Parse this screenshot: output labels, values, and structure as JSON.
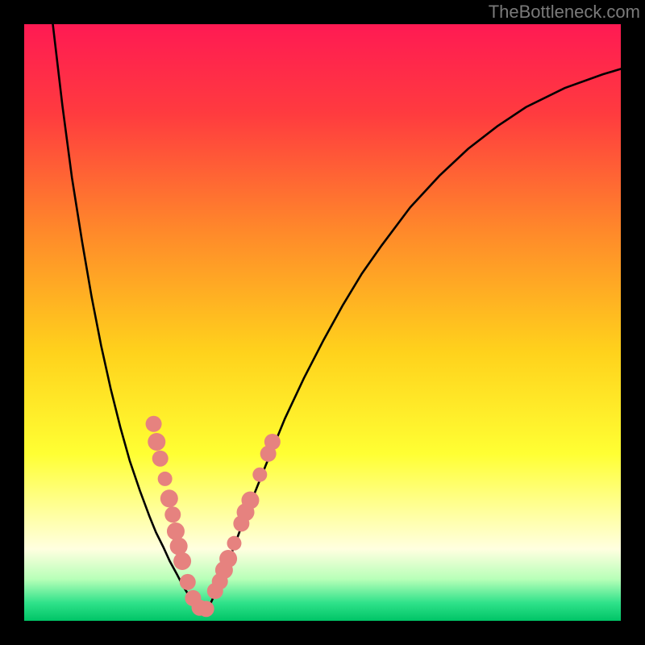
{
  "watermark": "TheBottleneck.com",
  "chart_data": {
    "type": "line",
    "title": "",
    "xlabel": "",
    "ylabel": "",
    "xlim": [
      0,
      1
    ],
    "ylim": [
      0,
      1
    ],
    "gradient_stops": [
      {
        "offset": 0.0,
        "color": "#ff1a53"
      },
      {
        "offset": 0.15,
        "color": "#ff3b3f"
      },
      {
        "offset": 0.35,
        "color": "#ff8a2a"
      },
      {
        "offset": 0.55,
        "color": "#ffd21c"
      },
      {
        "offset": 0.72,
        "color": "#ffff33"
      },
      {
        "offset": 0.82,
        "color": "#ffffa0"
      },
      {
        "offset": 0.88,
        "color": "#ffffe0"
      },
      {
        "offset": 0.93,
        "color": "#b8ffb8"
      },
      {
        "offset": 0.97,
        "color": "#2fe28a"
      },
      {
        "offset": 1.0,
        "color": "#00c466"
      }
    ],
    "series": [
      {
        "name": "left-branch",
        "x": [
          0.048,
          0.064,
          0.08,
          0.097,
          0.113,
          0.129,
          0.145,
          0.161,
          0.177,
          0.194,
          0.21,
          0.221,
          0.233,
          0.244,
          0.256,
          0.267,
          0.279,
          0.291
        ],
        "y": [
          1.0,
          0.864,
          0.743,
          0.636,
          0.543,
          0.461,
          0.389,
          0.325,
          0.268,
          0.218,
          0.175,
          0.148,
          0.124,
          0.1,
          0.078,
          0.057,
          0.038,
          0.02
        ]
      },
      {
        "name": "right-branch",
        "x": [
          0.308,
          0.324,
          0.34,
          0.356,
          0.372,
          0.389,
          0.405,
          0.437,
          0.469,
          0.502,
          0.534,
          0.566,
          0.599,
          0.647,
          0.696,
          0.744,
          0.793,
          0.841,
          0.906,
          0.97,
          1.0
        ],
        "y": [
          0.02,
          0.054,
          0.093,
          0.136,
          0.179,
          0.221,
          0.261,
          0.339,
          0.407,
          0.471,
          0.529,
          0.582,
          0.629,
          0.693,
          0.746,
          0.791,
          0.829,
          0.861,
          0.893,
          0.916,
          0.925
        ]
      }
    ],
    "floor": {
      "x0": 0.291,
      "x1": 0.308,
      "y": 0.02
    },
    "markers": [
      {
        "x": 0.217,
        "y": 0.33,
        "r": 10
      },
      {
        "x": 0.222,
        "y": 0.3,
        "r": 11
      },
      {
        "x": 0.228,
        "y": 0.272,
        "r": 10
      },
      {
        "x": 0.236,
        "y": 0.238,
        "r": 9
      },
      {
        "x": 0.243,
        "y": 0.205,
        "r": 11
      },
      {
        "x": 0.249,
        "y": 0.178,
        "r": 10
      },
      {
        "x": 0.254,
        "y": 0.15,
        "r": 11
      },
      {
        "x": 0.259,
        "y": 0.125,
        "r": 11
      },
      {
        "x": 0.265,
        "y": 0.1,
        "r": 11
      },
      {
        "x": 0.274,
        "y": 0.065,
        "r": 10
      },
      {
        "x": 0.283,
        "y": 0.038,
        "r": 10
      },
      {
        "x": 0.294,
        "y": 0.022,
        "r": 10
      },
      {
        "x": 0.305,
        "y": 0.02,
        "r": 10
      },
      {
        "x": 0.32,
        "y": 0.05,
        "r": 10
      },
      {
        "x": 0.328,
        "y": 0.066,
        "r": 10
      },
      {
        "x": 0.335,
        "y": 0.085,
        "r": 11
      },
      {
        "x": 0.342,
        "y": 0.104,
        "r": 11
      },
      {
        "x": 0.352,
        "y": 0.13,
        "r": 9
      },
      {
        "x": 0.364,
        "y": 0.163,
        "r": 10
      },
      {
        "x": 0.371,
        "y": 0.182,
        "r": 11
      },
      {
        "x": 0.379,
        "y": 0.202,
        "r": 11
      },
      {
        "x": 0.395,
        "y": 0.245,
        "r": 9
      },
      {
        "x": 0.409,
        "y": 0.28,
        "r": 10
      },
      {
        "x": 0.416,
        "y": 0.3,
        "r": 10
      }
    ],
    "marker_color": "#e6827f"
  }
}
